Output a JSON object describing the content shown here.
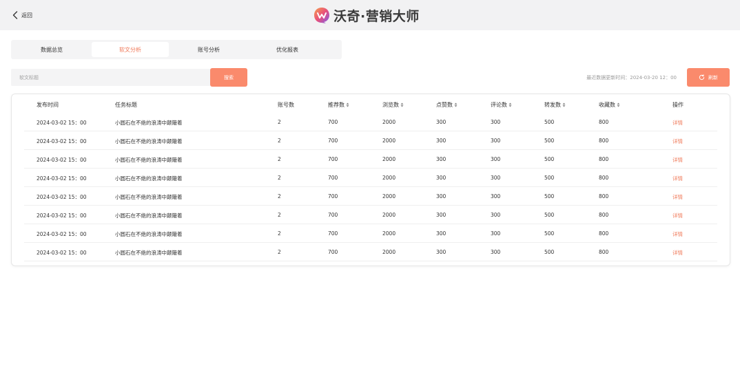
{
  "header": {
    "back_label": "返回",
    "brand_name": "沃奇·营销大师"
  },
  "tabs": [
    {
      "label": "数据总览",
      "active": false
    },
    {
      "label": "软文分析",
      "active": true
    },
    {
      "label": "账号分析",
      "active": false
    },
    {
      "label": "优化报表",
      "active": false
    }
  ],
  "search": {
    "placeholder": "软文标题",
    "button_label": "搜索"
  },
  "update_time": "最近数据更新时间：2024-03-20 12：00",
  "refresh_label": "刷新",
  "accent_color": "#fa8a6c",
  "table": {
    "columns": [
      "发布时间",
      "任务标题",
      "账号数",
      "推荐数",
      "浏览数",
      "点赞数",
      "评论数",
      "转发数",
      "收藏数",
      "操作"
    ],
    "sortable": [
      false,
      false,
      false,
      true,
      true,
      true,
      true,
      true,
      true,
      false
    ],
    "rows": [
      [
        "2024-03-02 15：00",
        "小圆石在不绝的浪涛中颠簸着",
        "2",
        "700",
        "2000",
        "300",
        "300",
        "500",
        "800",
        "详情"
      ],
      [
        "2024-03-02 15：00",
        "小圆石在不绝的浪涛中颠簸着",
        "2",
        "700",
        "2000",
        "300",
        "300",
        "500",
        "800",
        "详情"
      ],
      [
        "2024-03-02 15：00",
        "小圆石在不绝的浪涛中颠簸着",
        "2",
        "700",
        "2000",
        "300",
        "300",
        "500",
        "800",
        "详情"
      ],
      [
        "2024-03-02 15：00",
        "小圆石在不绝的浪涛中颠簸着",
        "2",
        "700",
        "2000",
        "300",
        "300",
        "500",
        "800",
        "详情"
      ],
      [
        "2024-03-02 15：00",
        "小圆石在不绝的浪涛中颠簸着",
        "2",
        "700",
        "2000",
        "300",
        "300",
        "500",
        "800",
        "详情"
      ],
      [
        "2024-03-02 15：00",
        "小圆石在不绝的浪涛中颠簸着",
        "2",
        "700",
        "2000",
        "300",
        "300",
        "500",
        "800",
        "详情"
      ],
      [
        "2024-03-02 15：00",
        "小圆石在不绝的浪涛中颠簸着",
        "2",
        "700",
        "2000",
        "300",
        "300",
        "500",
        "800",
        "详情"
      ],
      [
        "2024-03-02 15：00",
        "小圆石在不绝的浪涛中颠簸着",
        "2",
        "700",
        "2000",
        "300",
        "300",
        "500",
        "800",
        "详情"
      ]
    ]
  }
}
